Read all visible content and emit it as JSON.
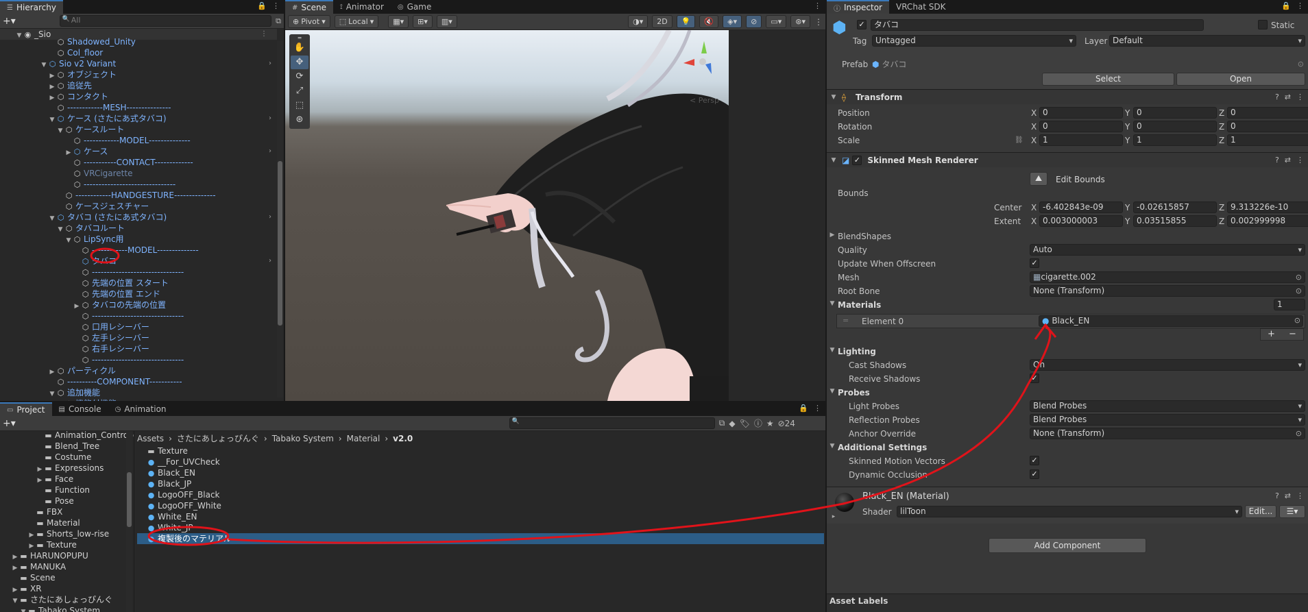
{
  "hierarchy": {
    "tab": "Hierarchy",
    "search_placeholder": "All",
    "root": "_Sio",
    "rows": [
      {
        "label": "Shadowed_Unity",
        "indent": 5,
        "icon": "go",
        "style": "blue",
        "arrow": ""
      },
      {
        "label": "Col_floor",
        "indent": 5,
        "icon": "go",
        "style": "blue",
        "arrow": ""
      },
      {
        "label": "Sio v2 Variant",
        "indent": 4,
        "icon": "pf",
        "style": "blue",
        "arrow": "down",
        "chev": true
      },
      {
        "label": "オブジェクト",
        "indent": 5,
        "icon": "go",
        "style": "blue",
        "arrow": "right"
      },
      {
        "label": "追従先",
        "indent": 5,
        "icon": "go",
        "style": "blue",
        "arrow": "right"
      },
      {
        "label": "コンタクト",
        "indent": 5,
        "icon": "go",
        "style": "blue",
        "arrow": "right"
      },
      {
        "label": "------------MESH---------------",
        "indent": 5,
        "icon": "go",
        "style": "blue",
        "arrow": ""
      },
      {
        "label": "ケース (さたにあ式タバコ)",
        "indent": 5,
        "icon": "pf",
        "style": "blue",
        "arrow": "down",
        "chev": true
      },
      {
        "label": "ケースルート",
        "indent": 6,
        "icon": "go",
        "style": "blue",
        "arrow": "down"
      },
      {
        "label": "------------MODEL--------------",
        "indent": 7,
        "icon": "go",
        "style": "blue",
        "arrow": ""
      },
      {
        "label": "ケース",
        "indent": 7,
        "icon": "pf",
        "style": "blue",
        "arrow": "right",
        "chev": true
      },
      {
        "label": "-----------CONTACT-------------",
        "indent": 7,
        "icon": "go",
        "style": "blue",
        "arrow": ""
      },
      {
        "label": "VRCigarette",
        "indent": 7,
        "icon": "go",
        "style": "dim",
        "arrow": ""
      },
      {
        "label": "-------------------------------",
        "indent": 7,
        "icon": "go",
        "style": "blue",
        "arrow": ""
      },
      {
        "label": "------------HANDGESTURE--------------",
        "indent": 6,
        "icon": "go",
        "style": "blue",
        "arrow": ""
      },
      {
        "label": "ケースジェスチャー",
        "indent": 6,
        "icon": "go",
        "style": "blue",
        "arrow": ""
      },
      {
        "label": "タバコ (さたにあ式タバコ)",
        "indent": 5,
        "icon": "pf",
        "style": "blue",
        "arrow": "down",
        "chev": true
      },
      {
        "label": "タバコルート",
        "indent": 6,
        "icon": "go",
        "style": "blue",
        "arrow": "down"
      },
      {
        "label": "LipSync用",
        "indent": 7,
        "icon": "go",
        "style": "blue",
        "arrow": "down"
      },
      {
        "label": "------------MODEL--------------",
        "indent": 8,
        "icon": "go",
        "style": "blue",
        "arrow": ""
      },
      {
        "label": "タバコ",
        "indent": 8,
        "icon": "pf",
        "style": "blue",
        "arrow": "",
        "chev": true,
        "selected": true
      },
      {
        "label": "-------------------------------",
        "indent": 8,
        "icon": "go",
        "style": "blue",
        "arrow": ""
      },
      {
        "label": "先端の位置 スタート",
        "indent": 8,
        "icon": "go",
        "style": "blue",
        "arrow": ""
      },
      {
        "label": "先端の位置 エンド",
        "indent": 8,
        "icon": "go",
        "style": "blue",
        "arrow": ""
      },
      {
        "label": "タバコの先端の位置",
        "indent": 8,
        "icon": "go",
        "style": "blue",
        "arrow": "right"
      },
      {
        "label": "-------------------------------",
        "indent": 8,
        "icon": "go",
        "style": "blue",
        "arrow": ""
      },
      {
        "label": "口用レシーバー",
        "indent": 8,
        "icon": "go",
        "style": "blue",
        "arrow": ""
      },
      {
        "label": "左手レシーバー",
        "indent": 8,
        "icon": "go",
        "style": "blue",
        "arrow": ""
      },
      {
        "label": "右手レシーバー",
        "indent": 8,
        "icon": "go",
        "style": "blue",
        "arrow": ""
      },
      {
        "label": "-------------------------------",
        "indent": 8,
        "icon": "go",
        "style": "blue",
        "arrow": ""
      },
      {
        "label": "パーティクル",
        "indent": 5,
        "icon": "go",
        "style": "blue",
        "arrow": "right"
      },
      {
        "label": "----------COMPONENT-----------",
        "indent": 5,
        "icon": "go",
        "style": "blue",
        "arrow": ""
      },
      {
        "label": "追加機能",
        "indent": 5,
        "icon": "go",
        "style": "blue",
        "arrow": "down"
      },
      {
        "label": "機能付機能",
        "indent": 6,
        "icon": "go",
        "style": "blue",
        "arrow": ""
      }
    ]
  },
  "scene": {
    "tabs": [
      "Scene",
      "Animator",
      "Game"
    ],
    "pivot": "Pivot",
    "local": "Local",
    "mode_2d": "2D",
    "persp": "< Persp"
  },
  "project": {
    "tabs": [
      "Project",
      "Console",
      "Animation"
    ],
    "count": "24",
    "tree": [
      {
        "label": "Animation_Controller",
        "indent": 4,
        "arrow": ""
      },
      {
        "label": "Blend_Tree",
        "indent": 4,
        "arrow": ""
      },
      {
        "label": "Costume",
        "indent": 4,
        "arrow": ""
      },
      {
        "label": "Expressions",
        "indent": 4,
        "arrow": "right"
      },
      {
        "label": "Face",
        "indent": 4,
        "arrow": "right"
      },
      {
        "label": "Function",
        "indent": 4,
        "arrow": ""
      },
      {
        "label": "Pose",
        "indent": 4,
        "arrow": ""
      },
      {
        "label": "FBX",
        "indent": 3,
        "arrow": ""
      },
      {
        "label": "Material",
        "indent": 3,
        "arrow": ""
      },
      {
        "label": "Shorts_low-rise",
        "indent": 3,
        "arrow": "right"
      },
      {
        "label": "Texture",
        "indent": 3,
        "arrow": "right"
      },
      {
        "label": "HARUNOPUPU",
        "indent": 1,
        "arrow": "right"
      },
      {
        "label": "MANUKA",
        "indent": 1,
        "arrow": "right"
      },
      {
        "label": "Scene",
        "indent": 1,
        "arrow": ""
      },
      {
        "label": "XR",
        "indent": 1,
        "arrow": "right"
      },
      {
        "label": "さたにあしょっぴんぐ",
        "indent": 1,
        "arrow": "down"
      },
      {
        "label": "Tabako System",
        "indent": 2,
        "arrow": "down"
      }
    ],
    "breadcrumb": [
      "Assets",
      "さたにあしょっぴんぐ",
      "Tabako System",
      "Material",
      "v2.0"
    ],
    "files": [
      {
        "label": "Texture",
        "icon": "folder"
      },
      {
        "label": "__For_UVCheck",
        "icon": "mat"
      },
      {
        "label": "Black_EN",
        "icon": "mat"
      },
      {
        "label": "Black_JP",
        "icon": "mat"
      },
      {
        "label": "LogoOFF_Black",
        "icon": "mat"
      },
      {
        "label": "LogoOFF_White",
        "icon": "mat"
      },
      {
        "label": "White_EN",
        "icon": "mat"
      },
      {
        "label": "White_JP",
        "icon": "mat"
      },
      {
        "label": "複製後のマテリアル",
        "icon": "mat",
        "selected": true
      }
    ]
  },
  "inspector": {
    "tabs": [
      "Inspector",
      "VRChat SDK"
    ],
    "object_name": "タバコ",
    "static_label": "Static",
    "tag_label": "Tag",
    "tag_value": "Untagged",
    "layer_label": "Layer",
    "layer_value": "Default",
    "prefab_label": "Prefab",
    "prefab_value": "タバコ",
    "select_btn": "Select",
    "open_btn": "Open",
    "transform": {
      "title": "Transform",
      "position_label": "Position",
      "rotation_label": "Rotation",
      "scale_label": "Scale",
      "position": [
        "0",
        "0",
        "0"
      ],
      "rotation": [
        "0",
        "0",
        "0"
      ],
      "scale": [
        "1",
        "1",
        "1"
      ]
    },
    "smr": {
      "title": "Skinned Mesh Renderer",
      "edit_bounds": "Edit Bounds",
      "bounds_label": "Bounds",
      "center_label": "Center",
      "extent_label": "Extent",
      "center": [
        "-6.402843e-09",
        "-0.02615857",
        "9.313226e-10"
      ],
      "extent": [
        "0.003000003",
        "0.03515855",
        "0.002999998"
      ],
      "blendshapes": "BlendShapes",
      "quality_label": "Quality",
      "quality_value": "Auto",
      "update_offscreen": "Update When Offscreen",
      "mesh_label": "Mesh",
      "mesh_value": "cigarette.002",
      "root_bone_label": "Root Bone",
      "root_bone_value": "None (Transform)",
      "materials_label": "Materials",
      "materials_count": "1",
      "element0_label": "Element 0",
      "element0_value": "Black_EN",
      "lighting_label": "Lighting",
      "cast_shadows_label": "Cast Shadows",
      "cast_shadows_value": "On",
      "receive_shadows_label": "Receive Shadows",
      "probes_label": "Probes",
      "light_probes_label": "Light Probes",
      "light_probes_value": "Blend Probes",
      "reflection_probes_label": "Reflection Probes",
      "reflection_probes_value": "Blend Probes",
      "anchor_override_label": "Anchor Override",
      "anchor_override_value": "None (Transform)",
      "additional_label": "Additional Settings",
      "skinned_motion_label": "Skinned Motion Vectors",
      "dynamic_occlusion_label": "Dynamic Occlusion"
    },
    "material": {
      "title": "Black_EN (Material)",
      "shader_label": "Shader",
      "shader_value": "lilToon",
      "edit_btn": "Edit..."
    },
    "add_component": "Add Component",
    "asset_labels": "Asset Labels"
  },
  "colors": {
    "accent": "#3a79bb",
    "selection": "#2c5d87",
    "annotation": "#e0131a"
  }
}
